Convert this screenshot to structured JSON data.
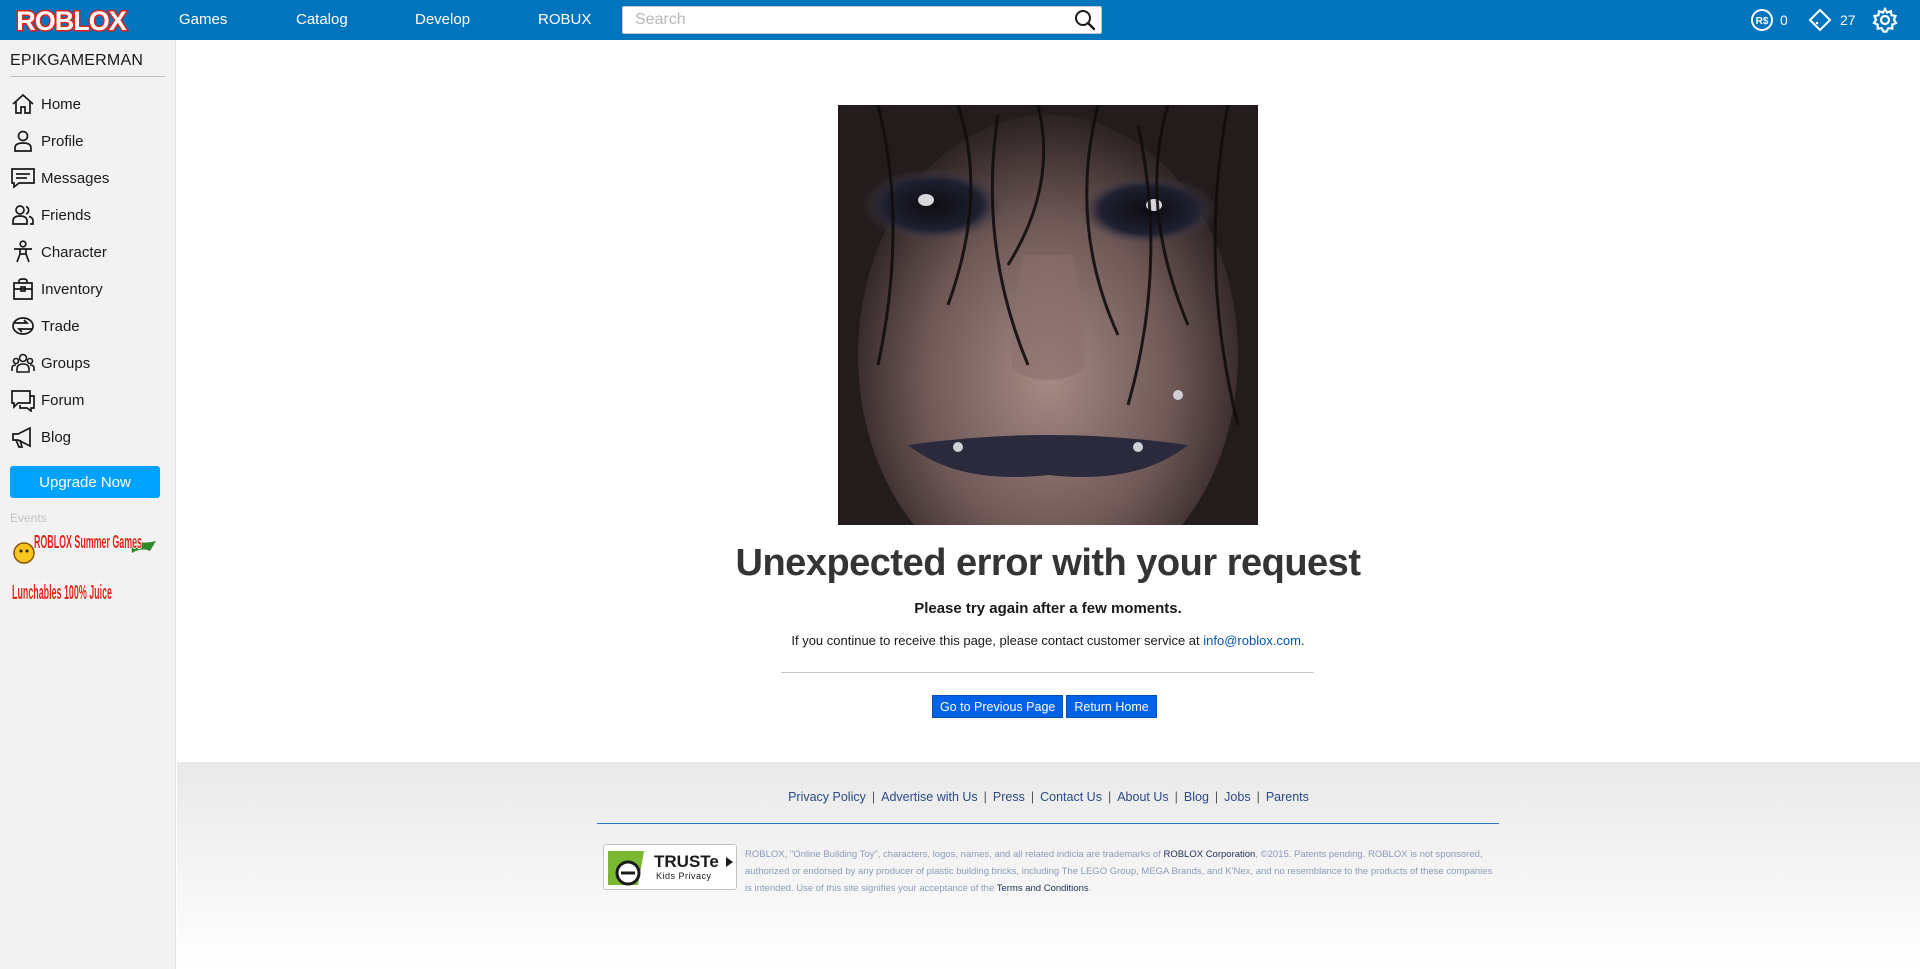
{
  "header": {
    "logo_text": "ROBLOX",
    "nav": [
      "Games",
      "Catalog",
      "Develop",
      "ROBUX"
    ],
    "search_placeholder": "Search",
    "robux_count": "0",
    "tickets_count": "27"
  },
  "sidebar": {
    "username": "EPIKGAMERMAN",
    "items": [
      {
        "label": "Home",
        "icon": "home-icon"
      },
      {
        "label": "Profile",
        "icon": "profile-icon"
      },
      {
        "label": "Messages",
        "icon": "messages-icon"
      },
      {
        "label": "Friends",
        "icon": "friends-icon"
      },
      {
        "label": "Character",
        "icon": "character-icon"
      },
      {
        "label": "Inventory",
        "icon": "inventory-icon"
      },
      {
        "label": "Trade",
        "icon": "trade-icon"
      },
      {
        "label": "Groups",
        "icon": "groups-icon"
      },
      {
        "label": "Forum",
        "icon": "forum-icon"
      },
      {
        "label": "Blog",
        "icon": "blog-icon"
      }
    ],
    "upgrade_label": "Upgrade Now",
    "events_label": "Events",
    "event_banners": [
      "ROBLOX Summer Games",
      "Lunchables 100% Juice"
    ]
  },
  "error": {
    "title": "Unexpected error with your request",
    "subtitle": "Please try again after a few moments.",
    "contact_prefix": "If you continue to receive this page, please contact customer service at ",
    "contact_email": "info@roblox.com",
    "contact_suffix": ".",
    "buttons": {
      "previous": "Go to Previous Page",
      "home": "Return Home"
    }
  },
  "footer": {
    "links": [
      "Privacy Policy",
      "Advertise with Us",
      "Press",
      "Contact Us",
      "About Us",
      "Blog",
      "Jobs",
      "Parents"
    ],
    "truste_title": "TRUSTe",
    "truste_sub": "Kids Privacy",
    "legal_part1": "ROBLOX, \"Online Building Toy\", characters, logos, names, and all related indicia are trademarks of ",
    "legal_corp": "ROBLOX Corporation",
    "legal_part2": ", ©2015. Patents pending. ROBLOX is not sponsored, authorized or endorsed by any producer of plastic building bricks, including The LEGO Group, MEGA Brands, and K'Nex, and no resemblance to the products of these companies is intended. Use of this site signifies your acceptance of the ",
    "legal_terms": "Terms and Conditions",
    "legal_end": "."
  },
  "colors": {
    "topbar": "#0074bd",
    "upgrade": "#00a2ff",
    "button": "#0062e6",
    "link": "#0055b3"
  }
}
